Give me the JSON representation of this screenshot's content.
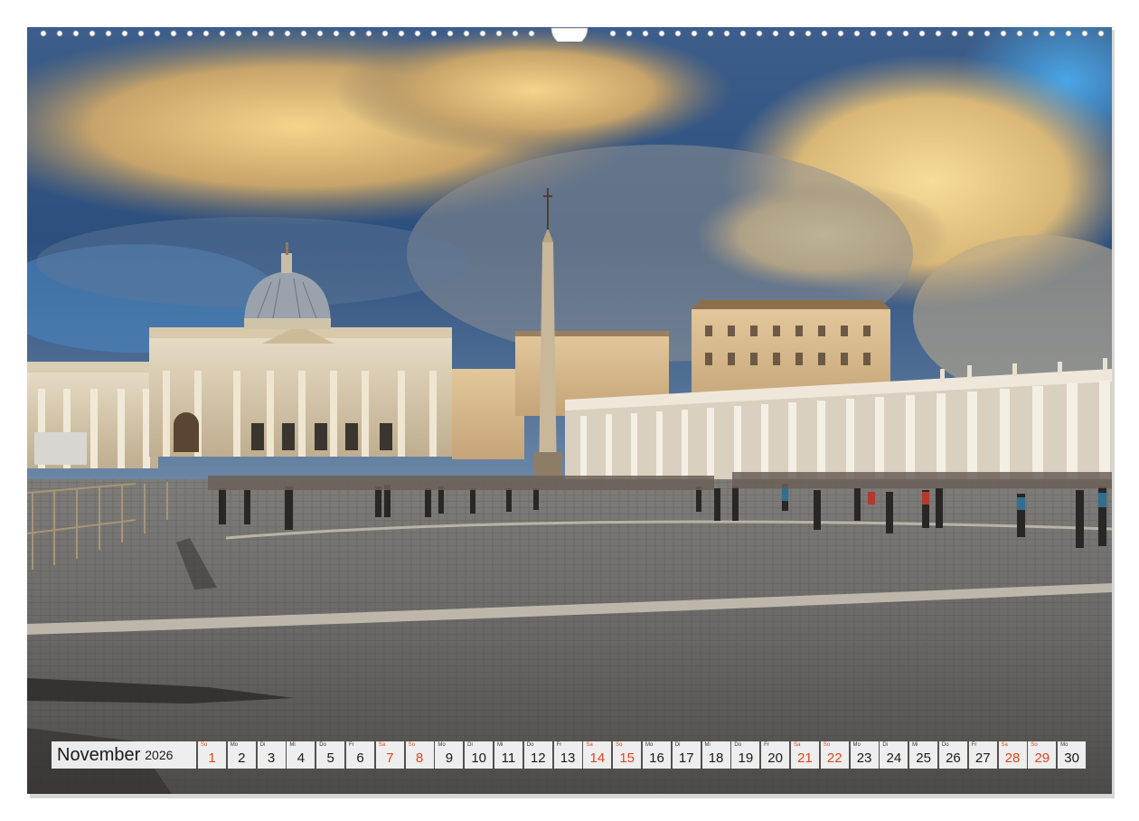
{
  "calendar": {
    "month": "November",
    "year": "2026",
    "days": [
      {
        "wd": "So",
        "num": "1",
        "weekend": true
      },
      {
        "wd": "Mo",
        "num": "2",
        "weekend": false
      },
      {
        "wd": "Di",
        "num": "3",
        "weekend": false
      },
      {
        "wd": "Mi",
        "num": "4",
        "weekend": false
      },
      {
        "wd": "Do",
        "num": "5",
        "weekend": false
      },
      {
        "wd": "Fr",
        "num": "6",
        "weekend": false
      },
      {
        "wd": "Sa",
        "num": "7",
        "weekend": true
      },
      {
        "wd": "So",
        "num": "8",
        "weekend": true
      },
      {
        "wd": "Mo",
        "num": "9",
        "weekend": false
      },
      {
        "wd": "Di",
        "num": "10",
        "weekend": false
      },
      {
        "wd": "Mi",
        "num": "11",
        "weekend": false
      },
      {
        "wd": "Do",
        "num": "12",
        "weekend": false
      },
      {
        "wd": "Fr",
        "num": "13",
        "weekend": false
      },
      {
        "wd": "Sa",
        "num": "14",
        "weekend": true
      },
      {
        "wd": "So",
        "num": "15",
        "weekend": true
      },
      {
        "wd": "Mo",
        "num": "16",
        "weekend": false
      },
      {
        "wd": "Di",
        "num": "17",
        "weekend": false
      },
      {
        "wd": "Mi",
        "num": "18",
        "weekend": false
      },
      {
        "wd": "Do",
        "num": "19",
        "weekend": false
      },
      {
        "wd": "Fr",
        "num": "20",
        "weekend": false
      },
      {
        "wd": "Sa",
        "num": "21",
        "weekend": true
      },
      {
        "wd": "So",
        "num": "22",
        "weekend": true
      },
      {
        "wd": "Mo",
        "num": "23",
        "weekend": false
      },
      {
        "wd": "Di",
        "num": "24",
        "weekend": false
      },
      {
        "wd": "Mi",
        "num": "25",
        "weekend": false
      },
      {
        "wd": "Do",
        "num": "26",
        "weekend": false
      },
      {
        "wd": "Fr",
        "num": "27",
        "weekend": false
      },
      {
        "wd": "Sa",
        "num": "28",
        "weekend": true
      },
      {
        "wd": "So",
        "num": "29",
        "weekend": true
      },
      {
        "wd": "Mo",
        "num": "30",
        "weekend": false
      }
    ]
  },
  "colors": {
    "weekend": "#e0451c",
    "weekday": "#1a1a1a",
    "cell_background": "#ffffff"
  }
}
